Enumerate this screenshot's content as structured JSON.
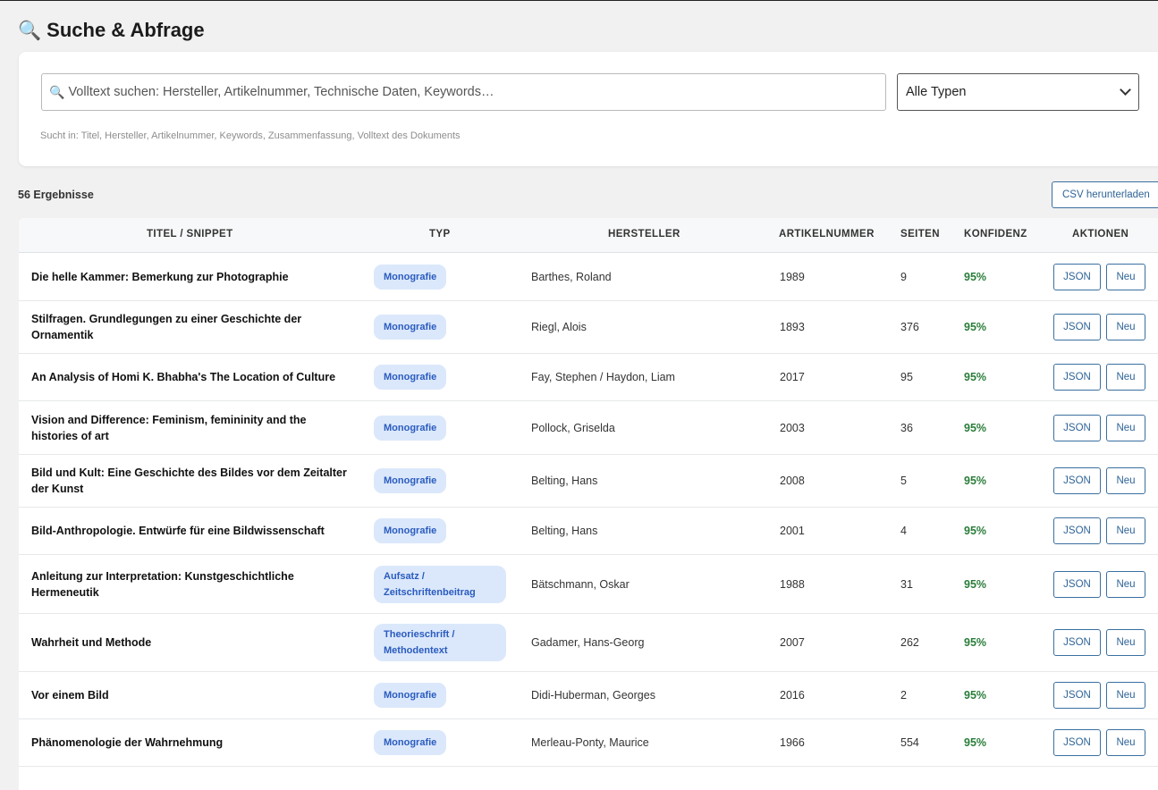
{
  "header": {
    "title": "Suche & Abfrage",
    "icon": "magnifier-icon"
  },
  "search": {
    "placeholder": "Volltext suchen: Hersteller, Artikelnummer, Technische Daten, Keywords…",
    "value": "",
    "type_filter": "Alle Typen",
    "hint": "Sucht in: Titel, Hersteller, Artikelnummer, Keywords, Zusammenfassung, Volltext des Dokuments"
  },
  "results": {
    "count_label": "56 Ergebnisse",
    "csv_label": "CSV herunterladen"
  },
  "table": {
    "headers": [
      "Titel / Snippet",
      "Typ",
      "Hersteller",
      "Artikelnummer",
      "Seiten",
      "Konfidenz",
      "Aktionen"
    ],
    "rows": [
      {
        "title": "Die helle Kammer: Bemerkung zur Photographie",
        "type": "Monografie",
        "manufacturer": "Barthes, Roland",
        "article": "1989",
        "pages": "9",
        "confidence": "95%",
        "json": "JSON",
        "neu": "Neu"
      },
      {
        "title": "Stilfragen. Grundlegungen zu einer Geschichte der Ornamentik",
        "type": "Monografie",
        "manufacturer": "Riegl, Alois",
        "article": "1893",
        "pages": "376",
        "confidence": "95%",
        "json": "JSON",
        "neu": "Neu"
      },
      {
        "title": "An Analysis of Homi K. Bhabha's The Location of Culture",
        "type": "Monografie",
        "manufacturer": "Fay, Stephen / Haydon, Liam",
        "article": "2017",
        "pages": "95",
        "confidence": "95%",
        "json": "JSON",
        "neu": "Neu"
      },
      {
        "title": "Vision and Difference: Feminism, femininity and the histories of art",
        "type": "Monografie",
        "manufacturer": "Pollock, Griselda",
        "article": "2003",
        "pages": "36",
        "confidence": "95%",
        "json": "JSON",
        "neu": "Neu"
      },
      {
        "title": "Bild und Kult: Eine Geschichte des Bildes vor dem Zeitalter der Kunst",
        "type": "Monografie",
        "manufacturer": "Belting, Hans",
        "article": "2008",
        "pages": "5",
        "confidence": "95%",
        "json": "JSON",
        "neu": "Neu"
      },
      {
        "title": "Bild-Anthropologie. Entwürfe für eine Bildwissenschaft",
        "type": "Monografie",
        "manufacturer": "Belting, Hans",
        "article": "2001",
        "pages": "4",
        "confidence": "95%",
        "json": "JSON",
        "neu": "Neu"
      },
      {
        "title": "Anleitung zur Interpretation: Kunstgeschichtliche Hermeneutik",
        "type": "Aufsatz / Zeitschriftenbeitrag",
        "manufacturer": "Bätschmann, Oskar",
        "article": "1988",
        "pages": "31",
        "confidence": "95%",
        "json": "JSON",
        "neu": "Neu"
      },
      {
        "title": "Wahrheit und Methode",
        "type": "Theorieschrift / Methodentext",
        "manufacturer": "Gadamer, Hans-Georg",
        "article": "2007",
        "pages": "262",
        "confidence": "95%",
        "json": "JSON",
        "neu": "Neu"
      },
      {
        "title": "Vor einem Bild",
        "type": "Monografie",
        "manufacturer": "Didi-Huberman, Georges",
        "article": "2016",
        "pages": "2",
        "confidence": "95%",
        "json": "JSON",
        "neu": "Neu"
      },
      {
        "title": "Phänomenologie der Wahrnehmung",
        "type": "Monografie",
        "manufacturer": "Merleau-Ponty, Maurice",
        "article": "1966",
        "pages": "554",
        "confidence": "95%",
        "json": "JSON",
        "neu": "Neu"
      }
    ]
  }
}
